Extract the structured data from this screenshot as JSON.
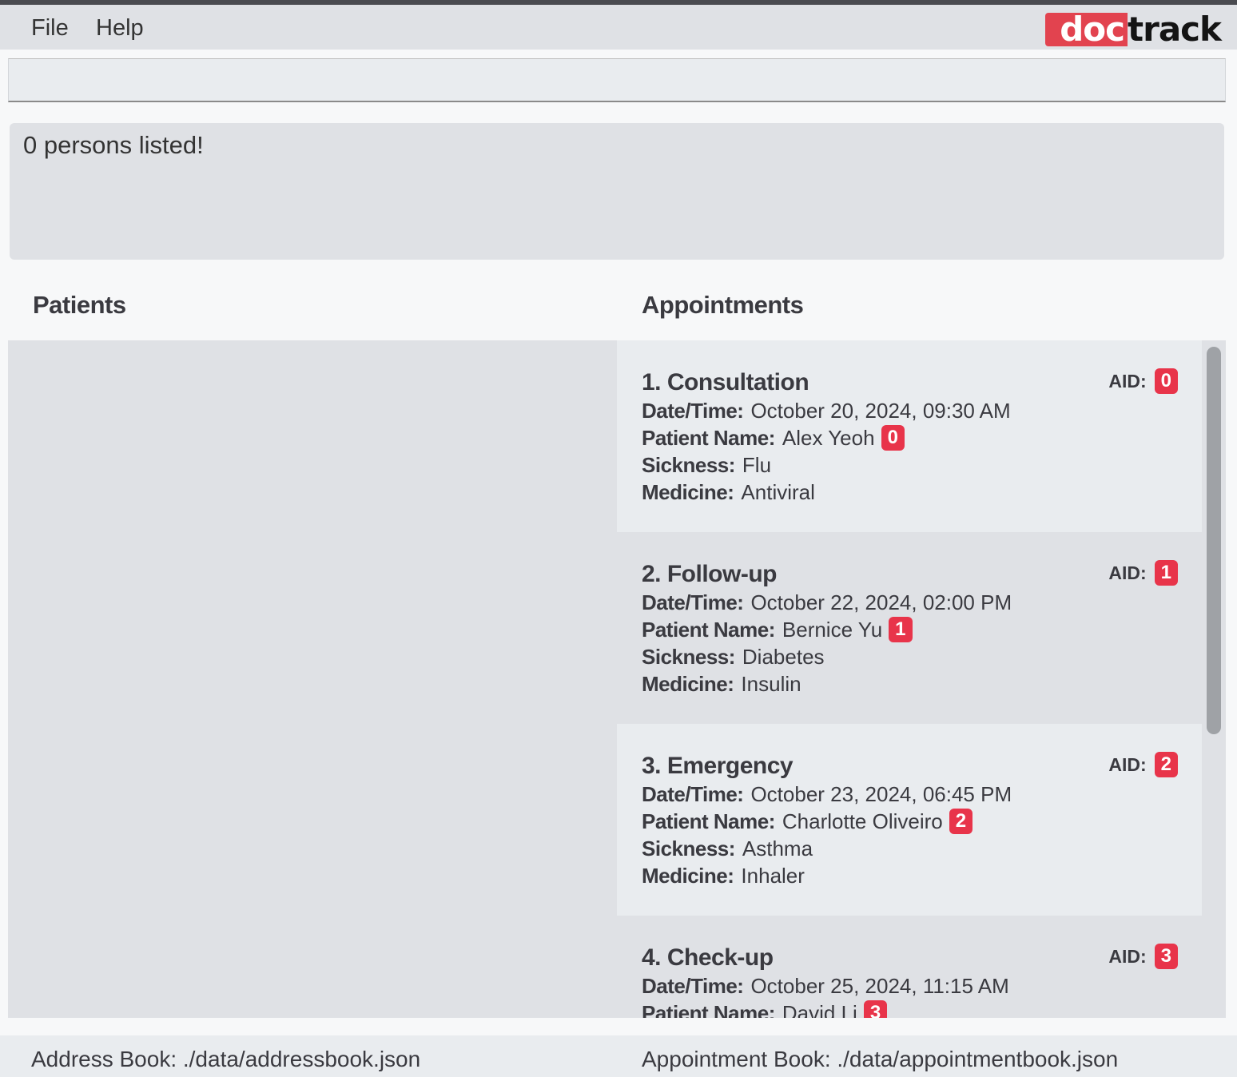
{
  "menu": {
    "file_label": "File",
    "help_label": "Help"
  },
  "logo": {
    "part1": "doc",
    "part2": "track"
  },
  "command": {
    "value": "",
    "placeholder": ""
  },
  "result": {
    "text": "0 persons listed!"
  },
  "patients": {
    "title": "Patients",
    "items": []
  },
  "appointments": {
    "title": "Appointments",
    "labels": {
      "aid": "AID:",
      "datetime": "Date/Time:",
      "patient_name": "Patient Name:",
      "sickness": "Sickness:",
      "medicine": "Medicine:"
    },
    "items": [
      {
        "title": "1. Consultation",
        "aid": "0",
        "datetime": "October 20, 2024, 09:30 AM",
        "patient_name": "Alex Yeoh",
        "patient_id": "0",
        "sickness": "Flu",
        "medicine": "Antiviral"
      },
      {
        "title": "2. Follow-up",
        "aid": "1",
        "datetime": "October 22, 2024, 02:00 PM",
        "patient_name": "Bernice Yu",
        "patient_id": "1",
        "sickness": "Diabetes",
        "medicine": "Insulin"
      },
      {
        "title": "3. Emergency",
        "aid": "2",
        "datetime": "October 23, 2024, 06:45 PM",
        "patient_name": "Charlotte Oliveiro",
        "patient_id": "2",
        "sickness": "Asthma",
        "medicine": "Inhaler"
      },
      {
        "title": "4. Check-up",
        "aid": "3",
        "datetime": "October 25, 2024, 11:15 AM",
        "patient_name": "David Li",
        "patient_id": "3",
        "sickness": "",
        "medicine": ""
      }
    ]
  },
  "status": {
    "address_book": "Address Book: ./data/addressbook.json",
    "appointment_book": "Appointment Book: ./data/appointmentbook.json"
  },
  "colors": {
    "badge": "#e8344a",
    "logo_red": "#e2434f"
  }
}
